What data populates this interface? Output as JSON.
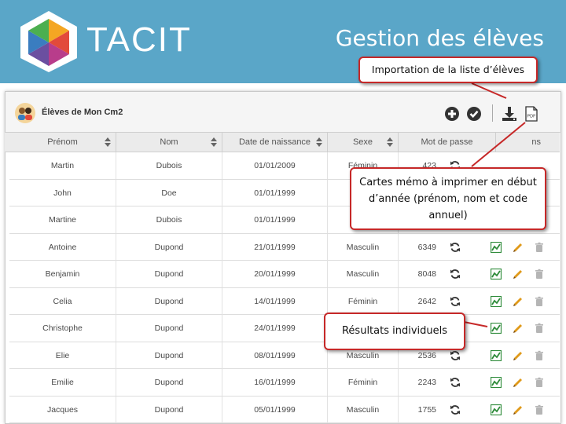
{
  "banner": {
    "brand": "TACIT",
    "slide_title": "Gestion des élèves"
  },
  "panel": {
    "class_name": "Élèves de Mon Cm2"
  },
  "toolbar": {
    "icons": [
      "add-icon",
      "check-icon",
      "download-icon",
      "pdf-icon"
    ],
    "pdf_label": "PDF"
  },
  "table": {
    "columns": [
      "Prénom",
      "Nom",
      "Date de naissance",
      "Sexe",
      "Mot de passe",
      "ns"
    ],
    "rows": [
      {
        "prenom": "Martin",
        "nom": "Dubois",
        "naissance": "01/01/2009",
        "sexe": "Féminin",
        "mdp": "423"
      },
      {
        "prenom": "John",
        "nom": "Doe",
        "naissance": "01/01/1999",
        "sexe": "Ma",
        "mdp": ""
      },
      {
        "prenom": "Martine",
        "nom": "Dubois",
        "naissance": "01/01/1999",
        "sexe": "",
        "mdp": ""
      },
      {
        "prenom": "Antoine",
        "nom": "Dupond",
        "naissance": "21/01/1999",
        "sexe": "Masculin",
        "mdp": "6349"
      },
      {
        "prenom": "Benjamin",
        "nom": "Dupond",
        "naissance": "20/01/1999",
        "sexe": "Masculin",
        "mdp": "8048"
      },
      {
        "prenom": "Celia",
        "nom": "Dupond",
        "naissance": "14/01/1999",
        "sexe": "Féminin",
        "mdp": "2642"
      },
      {
        "prenom": "Christophe",
        "nom": "Dupond",
        "naissance": "24/01/1999",
        "sexe": "",
        "mdp": ""
      },
      {
        "prenom": "Elie",
        "nom": "Dupond",
        "naissance": "08/01/1999",
        "sexe": "Masculin",
        "mdp": "2536"
      },
      {
        "prenom": "Emilie",
        "nom": "Dupond",
        "naissance": "16/01/1999",
        "sexe": "Féminin",
        "mdp": "2243"
      },
      {
        "prenom": "Jacques",
        "nom": "Dupond",
        "naissance": "05/01/1999",
        "sexe": "Masculin",
        "mdp": "1755"
      }
    ]
  },
  "callouts": {
    "import": "Importation de la liste d’élèves",
    "cards": "Cartes mémo à imprimer en début d’année (prénom, nom et code annuel)",
    "results": "Résultats individuels"
  },
  "colors": {
    "banner": "#5aa6c8",
    "callout_border": "#c62828",
    "results_icon": "#2e8b3a",
    "edit_icon": "#e09a1a",
    "delete_icon": "#b5b5b5"
  }
}
